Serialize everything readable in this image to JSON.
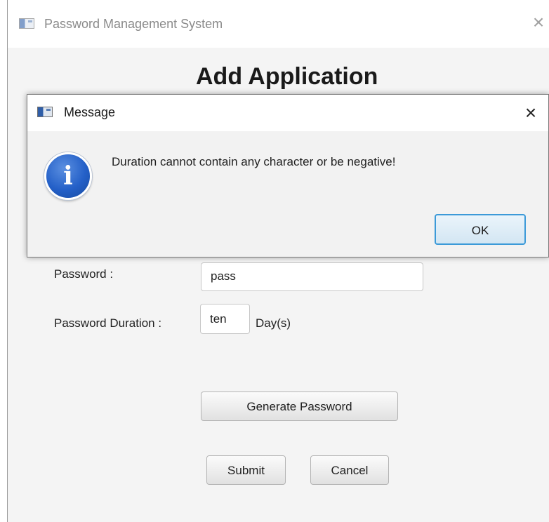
{
  "main_window": {
    "title": "Password Management System",
    "close_glyph": "×"
  },
  "page": {
    "heading": "Add Application"
  },
  "form": {
    "password_label": "Password :",
    "password_value": "pass",
    "duration_label": "Password Duration :",
    "duration_value": "ten",
    "duration_unit": "Day(s)"
  },
  "buttons": {
    "generate": "Generate Password",
    "submit": "Submit",
    "cancel": "Cancel"
  },
  "dialog": {
    "title": "Message",
    "close_glyph": "×",
    "icon_glyph": "i",
    "message": "Duration cannot contain any character or be negative!",
    "ok_label": "OK"
  },
  "icons": {
    "app": "app-window-icon",
    "info": "info-icon",
    "close": "close-icon"
  },
  "colors": {
    "info_icon": "#2460c8",
    "ok_border": "#3c9ad8"
  }
}
